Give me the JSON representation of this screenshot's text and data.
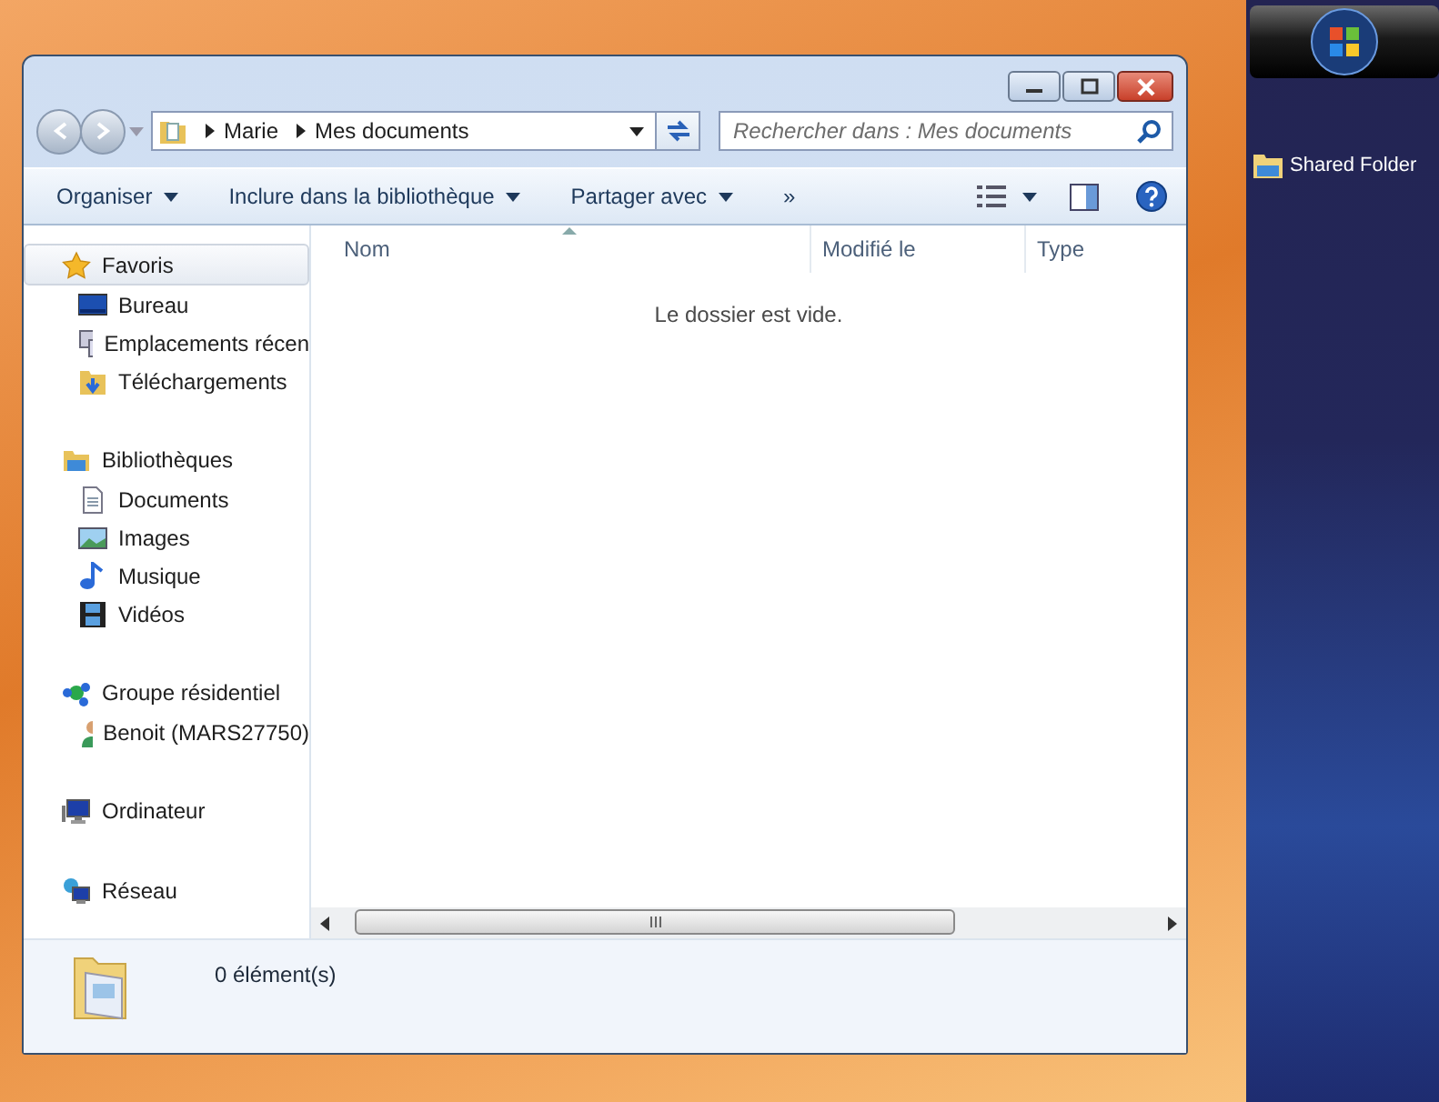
{
  "address_bar": {
    "breadcrumb": [
      "Marie",
      "Mes documents"
    ]
  },
  "search": {
    "placeholder": "Rechercher dans : Mes documents"
  },
  "toolbar": {
    "items": [
      {
        "label": "Organiser",
        "dropdown": true
      },
      {
        "label": "Inclure dans la bibliothèque",
        "dropdown": true
      },
      {
        "label": "Partager avec",
        "dropdown": true
      },
      {
        "label": "»",
        "dropdown": false
      }
    ]
  },
  "navigation": {
    "sections": [
      {
        "label": "Favoris",
        "kind": "star",
        "selected": true,
        "children": [
          {
            "label": "Bureau",
            "kind": "desktop"
          },
          {
            "label": "Emplacements récen",
            "kind": "recent"
          },
          {
            "label": "Téléchargements",
            "kind": "downloads"
          }
        ]
      },
      {
        "label": "Bibliothèques",
        "kind": "library",
        "selected": false,
        "children": [
          {
            "label": "Documents",
            "kind": "document"
          },
          {
            "label": "Images",
            "kind": "images"
          },
          {
            "label": "Musique",
            "kind": "music"
          },
          {
            "label": "Vidéos",
            "kind": "video"
          }
        ]
      },
      {
        "label": "Groupe résidentiel",
        "kind": "homegroup",
        "selected": false,
        "children": [
          {
            "label": "Benoit (MARS27750)",
            "kind": "user"
          }
        ]
      },
      {
        "label": "Ordinateur",
        "kind": "computer",
        "selected": false
      },
      {
        "label": "Réseau",
        "kind": "network",
        "selected": false
      }
    ]
  },
  "file_list": {
    "columns": [
      {
        "label": "Nom",
        "sorted": true
      },
      {
        "label": "Modifié le",
        "sorted": false
      },
      {
        "label": "Type",
        "sorted": false
      }
    ],
    "empty_message": "Le dossier est vide."
  },
  "status_bar": {
    "count": "0 élément(s)"
  },
  "desktop": {
    "shortcuts": [
      {
        "label": "Shared Folder"
      }
    ]
  }
}
